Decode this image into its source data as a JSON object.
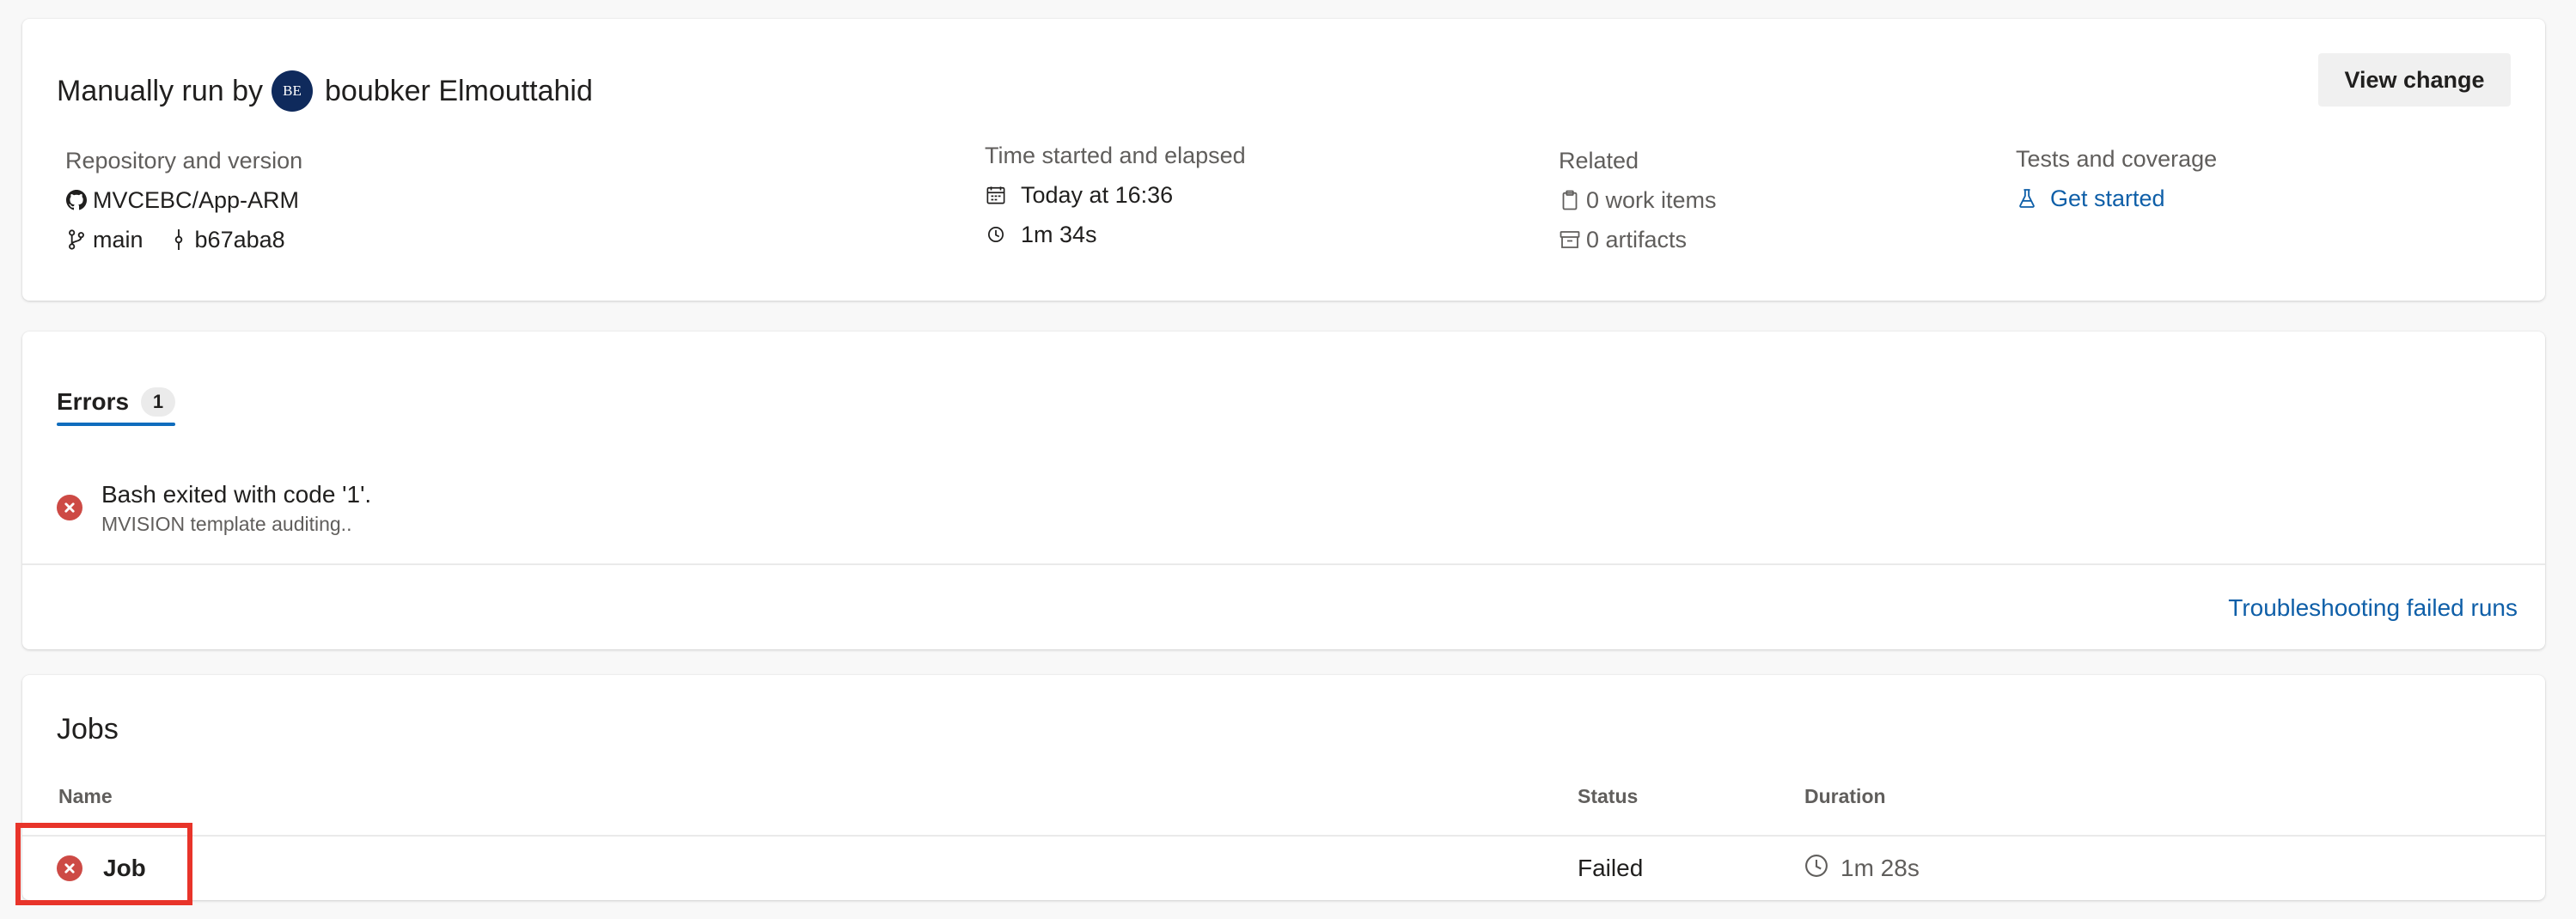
{
  "summary": {
    "run_by_prefix": "Manually run by",
    "user_initials": "BE",
    "user_name": "boubker Elmouttahid",
    "view_change_label": "View change",
    "repo": {
      "heading": "Repository and version",
      "repository": "MVCEBC/App-ARM",
      "branch": "main",
      "commit": "b67aba8"
    },
    "time": {
      "heading": "Time started and elapsed",
      "started": "Today at 16:36",
      "elapsed": "1m 34s"
    },
    "related": {
      "heading": "Related",
      "work_items": "0 work items",
      "artifacts": "0 artifacts"
    },
    "tests": {
      "heading": "Tests and coverage",
      "link": "Get started"
    }
  },
  "errors": {
    "tab_label": "Errors",
    "count": "1",
    "items": [
      {
        "title": "Bash exited with code '1'.",
        "subtitle": "MVISION template auditing.."
      }
    ],
    "troubleshoot_link": "Troubleshooting failed runs"
  },
  "jobs": {
    "title": "Jobs",
    "columns": [
      "Name",
      "Status",
      "Duration"
    ],
    "rows": [
      {
        "name": "Job",
        "status": "Failed",
        "duration": "1m 28s"
      }
    ]
  },
  "colors": {
    "error": "#cd4a45",
    "link": "#0f5fa8",
    "tab_underline": "#0f6cbd",
    "highlight": "#e8342a",
    "avatar": "#0f2a5c"
  },
  "icons": [
    "github-icon",
    "branch-icon",
    "commit-icon",
    "calendar-icon",
    "clock-icon",
    "clipboard-icon",
    "artifact-icon",
    "flask-icon",
    "error-icon"
  ]
}
